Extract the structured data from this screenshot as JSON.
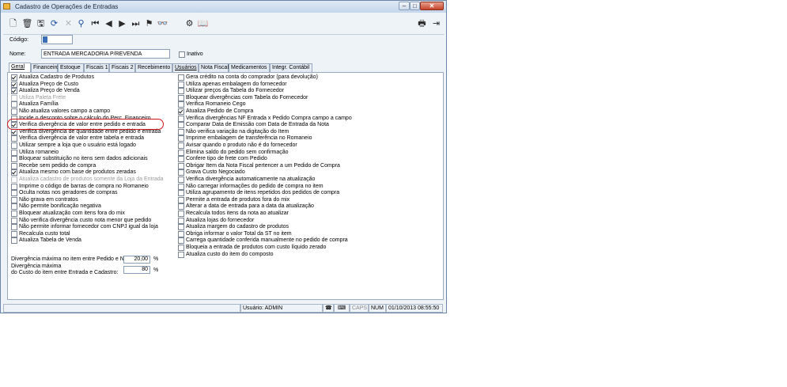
{
  "window": {
    "title": "Cadastro de Operações de Entradas"
  },
  "form": {
    "code_label": "Código:",
    "name_label": "Nome:",
    "name_value": "ENTRADA MERCADORIA P/REVENDA",
    "inactive_label": "Inativo"
  },
  "tabs": [
    "Geral",
    "Financeiro",
    "Estoque",
    "Fiscais 1",
    "Fiscais 2",
    "Recebimento",
    "Usuários",
    "Nota Fiscal",
    "Medicamentos",
    "Integr. Contábil"
  ],
  "left_options": [
    {
      "label": "Atualiza Cadastro de Produtos",
      "checked": true,
      "enabled": true
    },
    {
      "label": "Atualiza Preço de Custo",
      "checked": true,
      "enabled": true
    },
    {
      "label": "Atualiza Preço de Venda",
      "checked": true,
      "enabled": true
    },
    {
      "label": "Utiliza Paleta Frete",
      "checked": false,
      "enabled": false
    },
    {
      "label": "Atualiza Família",
      "checked": false,
      "enabled": true
    },
    {
      "label": "Não atualiza valores campo a campo",
      "checked": false,
      "enabled": true
    },
    {
      "label": "Incide o desconto sobre o cálculo do Perc. Financeiro",
      "checked": false,
      "enabled": true
    },
    {
      "label": "Verifica divergência de valor entre pedido e entrada",
      "checked": true,
      "enabled": true
    },
    {
      "label": "Verifica divergência de quantidade entre pedido e entrada",
      "checked": true,
      "enabled": true
    },
    {
      "label": "Verifica divergência de valor entre tabela e entrada",
      "checked": false,
      "enabled": true
    },
    {
      "label": "Utilizar sempre a loja que o usuário está logado",
      "checked": false,
      "enabled": true
    },
    {
      "label": "Utiliza romaneio",
      "checked": false,
      "enabled": true
    },
    {
      "label": "Bloquear substituição no itens sem dados adicionais",
      "checked": false,
      "enabled": true
    },
    {
      "label": "Recebe sem pedido de compra",
      "checked": false,
      "enabled": true
    },
    {
      "label": "Atualiza mesmo com base de produtos zeradas",
      "checked": true,
      "enabled": true
    },
    {
      "label": "Atualiza cadastro de produtos somente da Loja da Entrada",
      "checked": false,
      "enabled": false
    },
    {
      "label": "Imprime o código de barras de compra no Romaneio",
      "checked": false,
      "enabled": true
    },
    {
      "label": "Oculta notas nos geradores de compras",
      "checked": false,
      "enabled": true
    },
    {
      "label": "Não grava em contratos",
      "checked": false,
      "enabled": true
    },
    {
      "label": "Não permite bonificação negativa",
      "checked": false,
      "enabled": true
    },
    {
      "label": "Bloquear atualização com itens fora do mix",
      "checked": false,
      "enabled": true
    },
    {
      "label": "Não verifica divergência custo nota menor que pedido",
      "checked": false,
      "enabled": true
    },
    {
      "label": "Não permite informar fornecedor com CNPJ igual da loja",
      "checked": false,
      "enabled": true
    },
    {
      "label": "Recalcula custo total",
      "checked": false,
      "enabled": true
    },
    {
      "label": "Atualiza Tabela de Venda",
      "checked": false,
      "enabled": true
    }
  ],
  "right_options": [
    {
      "label": "Gera crédito na conta do comprador (para devolução)",
      "checked": false
    },
    {
      "label": "Utiliza apenas embalagem do fornecedor",
      "checked": false
    },
    {
      "label": "Utilizar preços da Tabela do Fornecedor",
      "checked": false
    },
    {
      "label": "Bloquear divergências com Tabela do Fornecedor",
      "checked": false
    },
    {
      "label": "Verifica Romaneio Cego",
      "checked": false
    },
    {
      "label": "Atualiza Pedido de Compra",
      "checked": true
    },
    {
      "label": "Verifica divergências NF Entrada x Pedido Compra campo a campo",
      "checked": false
    },
    {
      "label": "Comparar Data de Emissão com Data de Entrada da Nota",
      "checked": false
    },
    {
      "label": "Não verifica variação na digitação do Item",
      "checked": false
    },
    {
      "label": "Imprime embalagem de transferência no Romaneio",
      "checked": false
    },
    {
      "label": "Avisar quando o produto não é do fornecedor",
      "checked": false
    },
    {
      "label": "Elimina saldo do pedido sem confirmação",
      "checked": false
    },
    {
      "label": "Confere tipo de frete com Pedido",
      "checked": false
    },
    {
      "label": "Obrigar Item da Nota Fiscal pertencer a um Pedido de Compra",
      "checked": false
    },
    {
      "label": "Grava Custo Negociado",
      "checked": false
    },
    {
      "label": "Verifica divergência automaticamente na atualização",
      "checked": false
    },
    {
      "label": "Não carregar informações do pedido de compra no item",
      "checked": false
    },
    {
      "label": "Utiliza agrupamento de itens repetidos dos pedidos de compra",
      "checked": false
    },
    {
      "label": "Permite a entrada de produtos fora do mix",
      "checked": false
    },
    {
      "label": "Alterar a data de entrada para a data da atualização",
      "checked": false
    },
    {
      "label": "Recalcula todos itens da nota ao atualizar",
      "checked": false
    },
    {
      "label": "Atualiza lojas do fornecedor",
      "checked": false
    },
    {
      "label": "Atualiza margem do cadastro de produtos",
      "checked": false
    },
    {
      "label": "Obriga informar o valor Total da ST no item",
      "checked": false
    },
    {
      "label": "Carrega quantidade conferida manualmente no pedido de compra",
      "checked": false
    },
    {
      "label": "Bloqueia a entrada de produtos com custo líquido zerado",
      "checked": false
    },
    {
      "label": "Atualiza custo do item do composto",
      "checked": false
    }
  ],
  "divergence": {
    "order_label": "Divergência máxima no item entre Pedido e NF:",
    "order_value": "20,00",
    "order_unit": "%",
    "cost_label_1": "Divergência máxima",
    "cost_label_2": "do Custo do item entre Entrada e Cadastro:",
    "cost_value": "80",
    "cost_unit": "%"
  },
  "status": {
    "user": "Usuário: ADMIN",
    "caps": "CAPS",
    "num": "NUM",
    "datetime": "01/10/2013 08:55:50"
  },
  "annotation_color": "#d0161b"
}
